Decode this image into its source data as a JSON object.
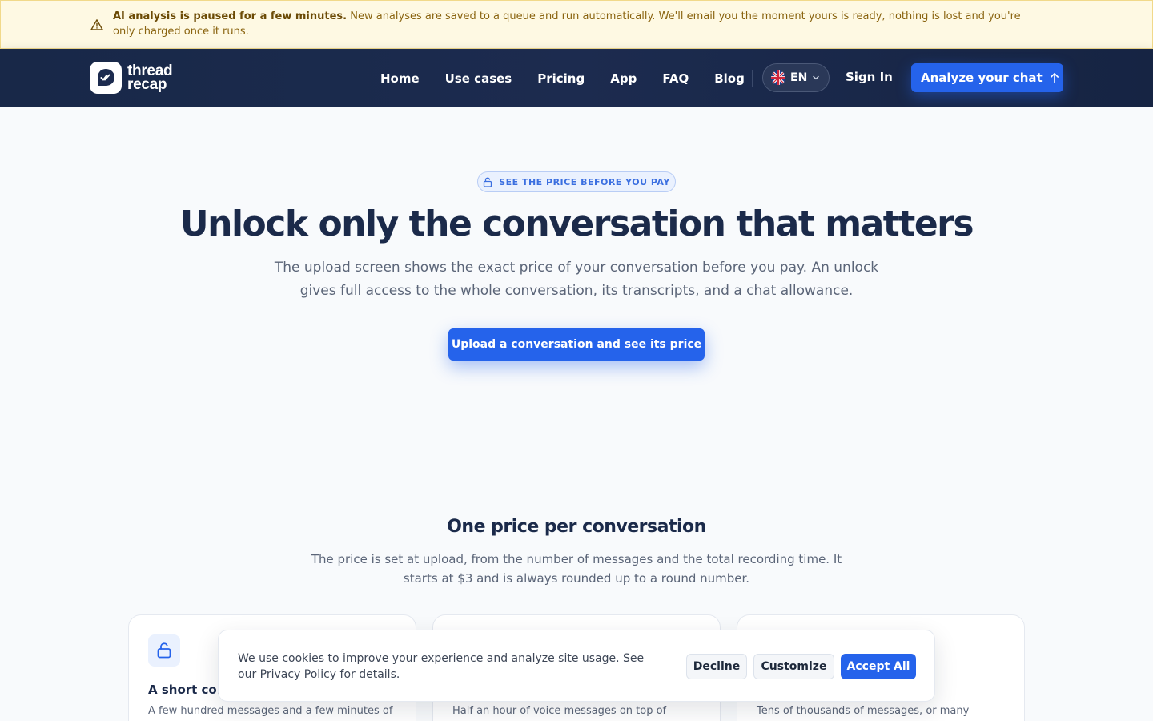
{
  "alert": {
    "title": "AI analysis is paused for a few minutes.",
    "body": " New analyses are saved to a queue and run automatically. We'll email you the moment yours is ready, nothing is lost and you're only charged once it runs."
  },
  "nav": {
    "logo_line1": "thread",
    "logo_line2": "recap",
    "links": [
      "Home",
      "Use cases",
      "Pricing",
      "App",
      "FAQ",
      "Blog"
    ],
    "language": "EN",
    "sign_in": "Sign In",
    "cta": "Analyze your chat"
  },
  "hero": {
    "badge": "SEE THE PRICE BEFORE YOU PAY",
    "title": "Unlock only the conversation that matters",
    "subtitle": "The upload screen shows the exact price of your conversation before you pay. An unlock gives full access to the whole conversation, its transcripts, and a chat allowance.",
    "button": "Upload a conversation and see its price"
  },
  "pricing": {
    "title": "One price per conversation",
    "subtitle": "The price is set at upload, from the number of messages and the total recording time. It starts at $3 and is always rounded up to a round number.",
    "cards": [
      {
        "title": "A short cor",
        "text": "A few hundred messages and a few minutes of"
      },
      {
        "title": "",
        "text": "Half an hour of voice messages on top of"
      },
      {
        "title": "",
        "text": "Tens of thousands of messages, or many"
      }
    ]
  },
  "cookie": {
    "text_before": "We use cookies to improve your experience and analyze site usage. See our ",
    "link": "Privacy Policy",
    "text_after": " for details.",
    "decline": "Decline",
    "customize": "Customize",
    "accept": "Accept All"
  },
  "colors": {
    "accent": "#2563eb",
    "nav_bg": "#1c2b4f",
    "alert_bg": "#fef9e3",
    "heading": "#1b2a4a"
  }
}
